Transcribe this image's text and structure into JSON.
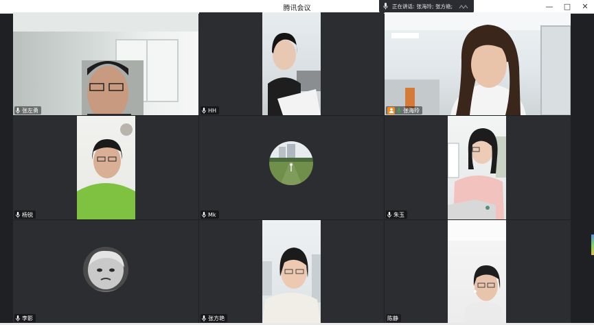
{
  "window": {
    "title": "腾讯会议",
    "controls": {
      "minimize": "—",
      "maximize": "□",
      "close": "✕"
    }
  },
  "speaking_indicator": {
    "label": "正在讲话:",
    "names": "张海玲; 张方艳;"
  },
  "participants": [
    {
      "name": "张左勇",
      "muted": false,
      "host": false,
      "speaking": false
    },
    {
      "name": "HH",
      "muted": false,
      "host": false,
      "speaking": false
    },
    {
      "name": "张海玲",
      "muted": false,
      "host": true,
      "speaking": true
    },
    {
      "name": "杨锐",
      "muted": false,
      "host": false,
      "speaking": false
    },
    {
      "name": "Mk",
      "muted": false,
      "host": false,
      "speaking": false
    },
    {
      "name": "朱玉",
      "muted": false,
      "host": false,
      "speaking": false
    },
    {
      "name": "李影",
      "muted": false,
      "host": false,
      "speaking": false
    },
    {
      "name": "张方艳",
      "muted": false,
      "host": false,
      "speaking": true
    },
    {
      "name": "陈静",
      "muted": false,
      "host": false,
      "speaking": false
    }
  ],
  "colors": {
    "background": "#1f2023",
    "tile": "#2b2d31",
    "active_border": "#3fae52",
    "host_badge": "#f28c1e",
    "speaking_mic": "#3fae52"
  }
}
